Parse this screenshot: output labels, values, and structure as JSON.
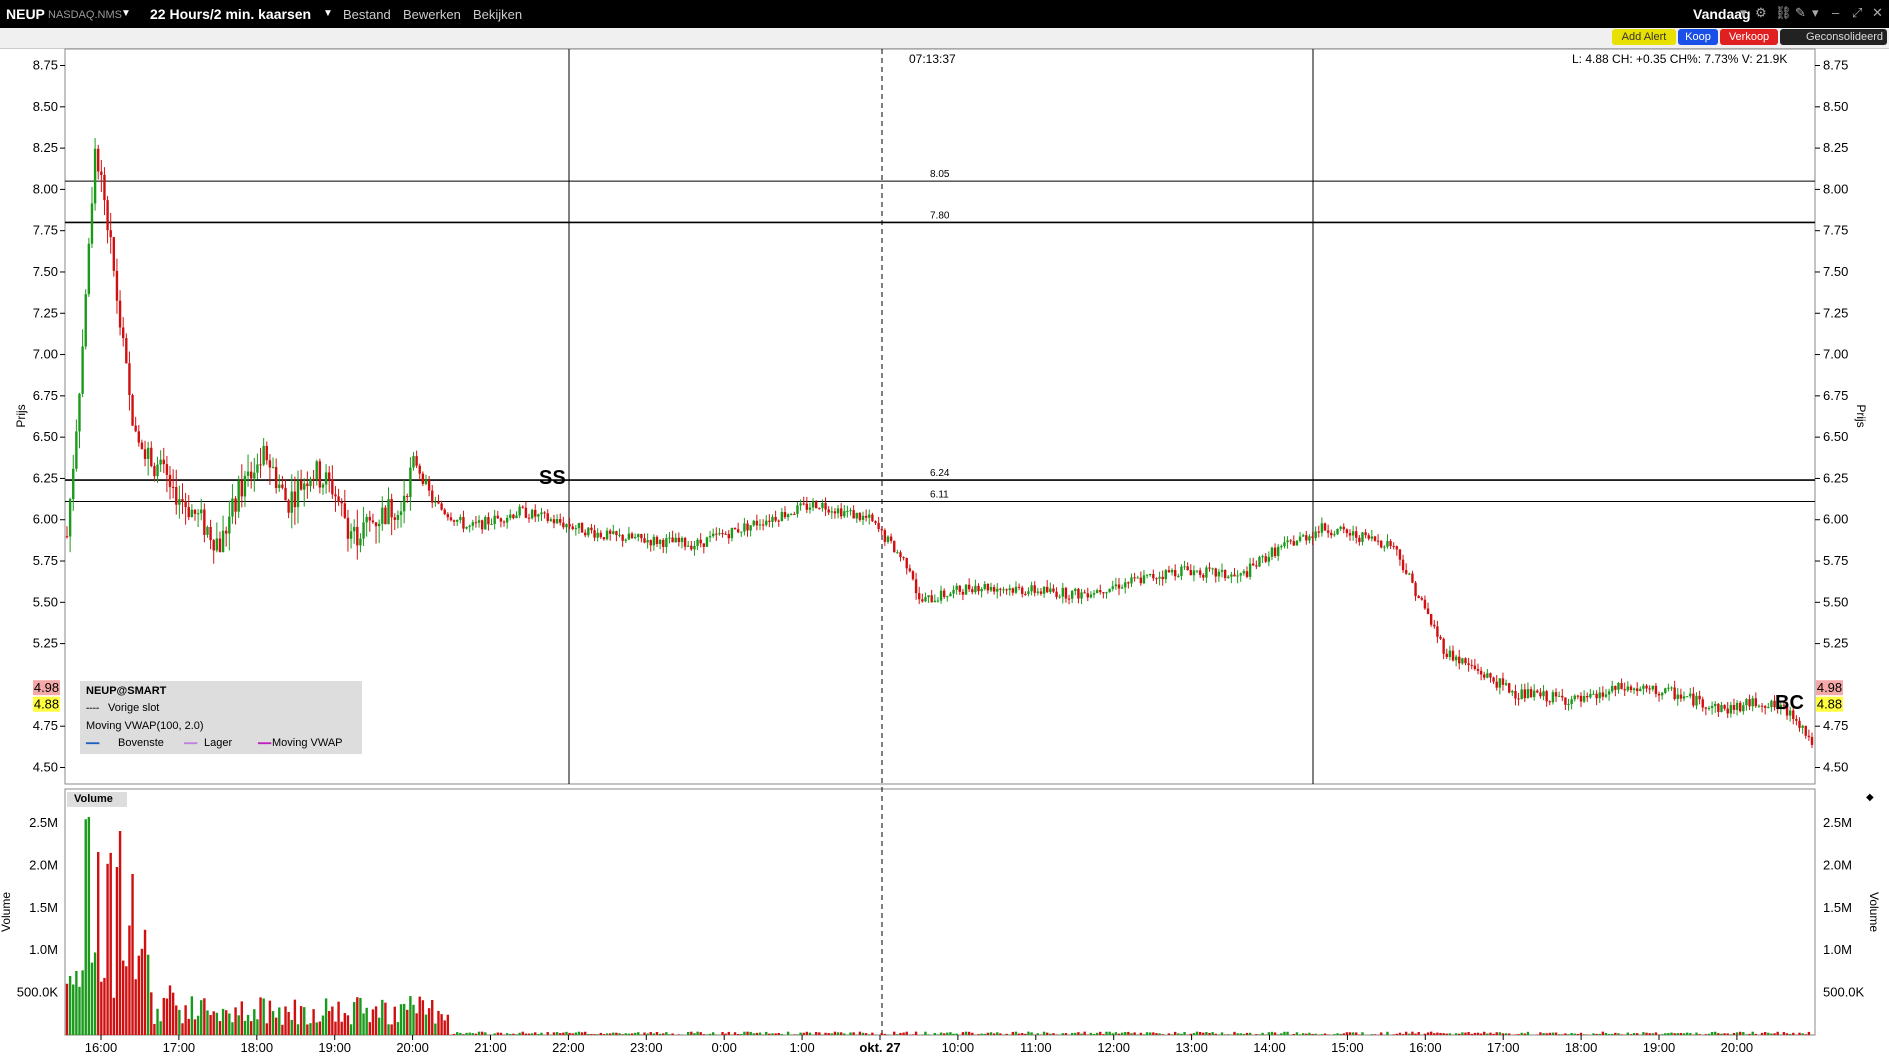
{
  "header": {
    "symbol": "NEUP",
    "exchange": "NASDAQ.NMS",
    "timeframe": "22 Hours/2 min. kaarsen",
    "menus": [
      "Bestand",
      "Bewerken",
      "Bekijken"
    ],
    "range_label": "Vandaag"
  },
  "order_buttons": {
    "add_alert": "Add Alert",
    "buy": "Koop",
    "sell": "Verkoop",
    "consolidated": "Geconsolideerd"
  },
  "price_panel": {
    "ylabel": "Prijs",
    "ticks": [
      "8.75",
      "8.50",
      "8.25",
      "8.00",
      "7.75",
      "7.50",
      "7.25",
      "7.00",
      "6.75",
      "6.50",
      "6.25",
      "6.00",
      "5.75",
      "5.50",
      "5.25",
      "4.75",
      "4.50"
    ],
    "tick_values": [
      8.75,
      8.5,
      8.25,
      8.0,
      7.75,
      7.5,
      7.25,
      7.0,
      6.75,
      6.5,
      6.25,
      6.0,
      5.75,
      5.5,
      5.25,
      4.75,
      4.5
    ],
    "last_price_label": "4.88",
    "prev_close_label": "4.98",
    "cursor_time": "07:13:37",
    "quote": "L: 4.88 CH: +0.35 CH%: 7.73% V: 21.9K",
    "annotations": [
      "SS",
      "BC"
    ],
    "hlines": [
      {
        "value": 8.05,
        "label": "8.05"
      },
      {
        "value": 7.8,
        "label": "7.80"
      },
      {
        "value": 6.24,
        "label": "6.24"
      },
      {
        "value": 6.11,
        "label": "6.11"
      }
    ]
  },
  "legend": {
    "title": "NEUP@SMART",
    "prev_close": "Vorige slot",
    "indicator": "Moving VWAP(100, 2.0)",
    "upper": "Bovenste",
    "lower": "Lager",
    "vwap": "Moving VWAP"
  },
  "volume_panel": {
    "title": "Volume",
    "ylabel": "Volume",
    "ticks": [
      "2.5M",
      "2.0M",
      "1.5M",
      "1.0M",
      "500.0K"
    ],
    "tick_values": [
      2500000,
      2000000,
      1500000,
      1000000,
      500000
    ]
  },
  "x_axis": {
    "labels": [
      "16:00",
      "17:00",
      "18:00",
      "19:00",
      "20:00",
      "21:00",
      "22:00",
      "23:00",
      "0:00",
      "1:00",
      "okt. 27",
      "10:00",
      "11:00",
      "12:00",
      "13:00",
      "14:00",
      "15:00",
      "16:00",
      "17:00",
      "18:00",
      "19:00",
      "20:00"
    ]
  },
  "colors": {
    "up": "#1a9a1a",
    "down": "#d01010",
    "grid": "#000000"
  },
  "chart_data": {
    "type": "candlestick",
    "ylim": [
      4.4,
      8.85
    ],
    "volume_ylim": [
      0,
      2900000
    ],
    "anchors": [
      [
        0,
        5.9
      ],
      [
        0.02,
        6.4
      ],
      [
        0.05,
        7.2
      ],
      [
        0.08,
        8.3
      ],
      [
        0.11,
        7.9
      ],
      [
        0.14,
        7.4
      ],
      [
        0.18,
        6.7
      ],
      [
        0.23,
        6.4
      ],
      [
        0.3,
        6.2
      ],
      [
        0.38,
        6.0
      ],
      [
        0.44,
        5.85
      ],
      [
        0.5,
        6.2
      ],
      [
        0.57,
        6.4
      ],
      [
        0.63,
        6.1
      ],
      [
        0.7,
        6.3
      ],
      [
        0.76,
        6.2
      ],
      [
        0.82,
        5.9
      ],
      [
        0.88,
        6.0
      ],
      [
        0.95,
        6.1
      ],
      [
        1.0,
        6.35
      ],
      [
        1.05,
        6.1
      ],
      [
        1.15,
        5.95
      ],
      [
        1.3,
        6.05
      ],
      [
        1.55,
        5.9
      ],
      [
        1.8,
        5.85
      ],
      [
        2.0,
        6.0
      ],
      [
        2.15,
        6.1
      ],
      [
        2.3,
        6.0
      ],
      [
        2.42,
        5.7
      ],
      [
        2.44,
        5.5
      ],
      [
        2.6,
        5.6
      ],
      [
        2.9,
        5.55
      ],
      [
        3.2,
        5.7
      ],
      [
        3.36,
        5.65
      ],
      [
        3.45,
        5.8
      ],
      [
        3.6,
        5.95
      ],
      [
        3.8,
        5.85
      ],
      [
        3.95,
        5.2
      ],
      [
        4.15,
        4.95
      ],
      [
        4.35,
        4.9
      ],
      [
        4.45,
        4.98
      ],
      [
        4.6,
        4.95
      ],
      [
        4.75,
        4.85
      ],
      [
        4.85,
        4.9
      ],
      [
        4.95,
        4.82
      ],
      [
        5.0,
        4.65
      ]
    ],
    "volume_spikes": [
      [
        0.06,
        2.8
      ],
      [
        0.09,
        2.5
      ],
      [
        0.12,
        1.7
      ],
      [
        0.15,
        2.0
      ],
      [
        0.18,
        1.2
      ],
      [
        0.22,
        0.9
      ],
      [
        0.3,
        0.6
      ],
      [
        0.45,
        0.35
      ],
      [
        0.55,
        0.25
      ],
      [
        0.8,
        0.28
      ],
      [
        0.95,
        0.15
      ]
    ]
  }
}
